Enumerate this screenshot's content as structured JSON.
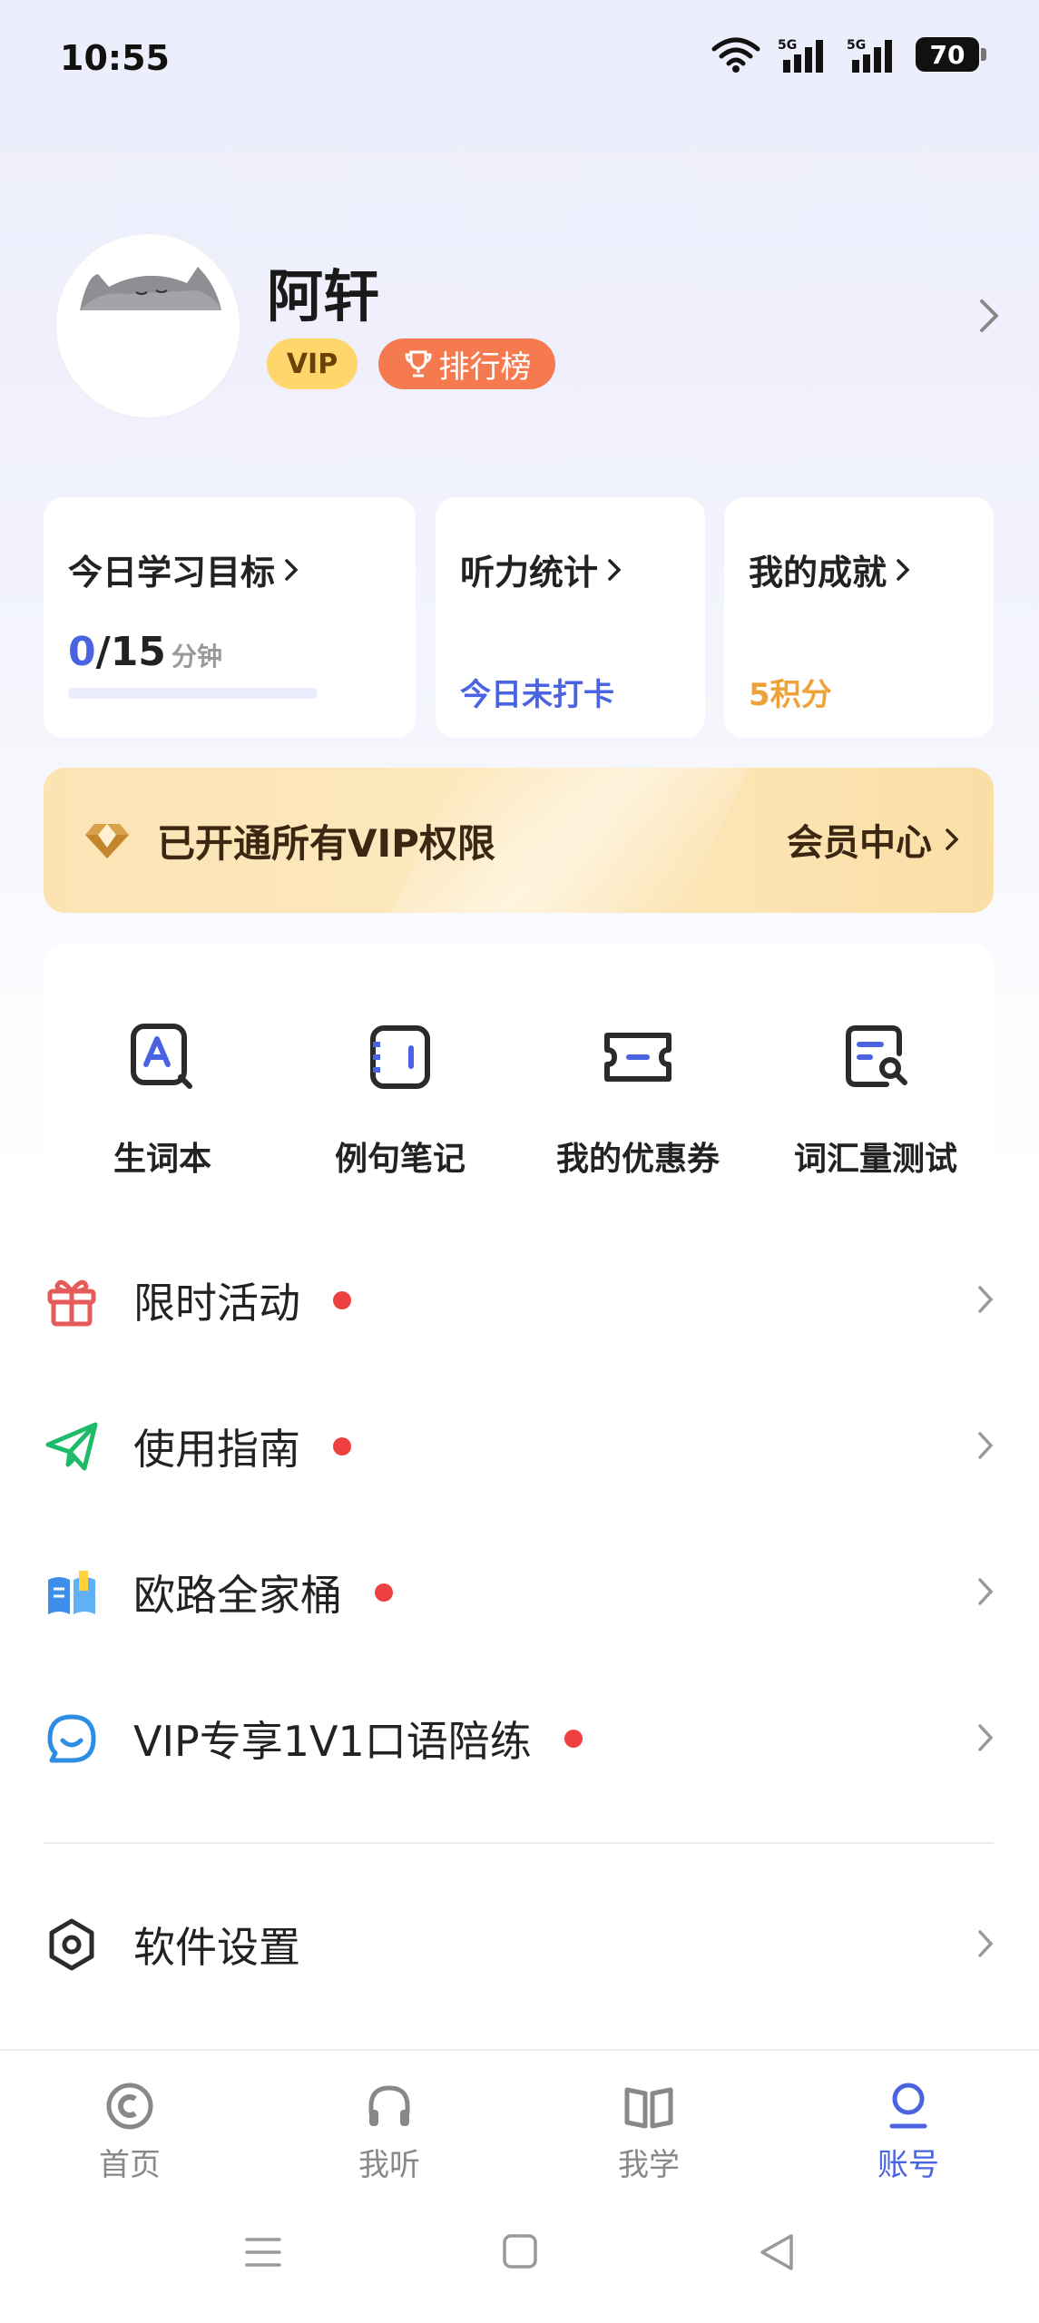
{
  "status_bar": {
    "time": "10:55",
    "battery": "70",
    "signal1": "5G",
    "signal2": "5G"
  },
  "profile": {
    "name": "阿轩",
    "vip_label": "VIP",
    "rank_label": "排行榜"
  },
  "cards": {
    "goal": {
      "title": "今日学习目标",
      "current": "0",
      "total": "/15",
      "unit": "分钟",
      "progress": 0
    },
    "listening": {
      "title": "听力统计",
      "status": "今日未打卡"
    },
    "achievement": {
      "title": "我的成就",
      "points": "5积分"
    }
  },
  "vip_banner": {
    "text": "已开通所有VIP权限",
    "center_label": "会员中心"
  },
  "tools": [
    {
      "label": "生词本",
      "icon": "vocabulary-book-icon"
    },
    {
      "label": "例句笔记",
      "icon": "sentence-notes-icon"
    },
    {
      "label": "我的优惠券",
      "icon": "coupon-icon"
    },
    {
      "label": "词汇量测试",
      "icon": "vocabulary-test-icon"
    }
  ],
  "menu": [
    {
      "label": "限时活动",
      "icon": "gift-icon",
      "has_dot": true
    },
    {
      "label": "使用指南",
      "icon": "paper-plane-icon",
      "has_dot": true
    },
    {
      "label": "欧路全家桶",
      "icon": "book-bundle-icon",
      "has_dot": true
    },
    {
      "label": "VIP专享1V1口语陪练",
      "icon": "chat-bubble-icon",
      "has_dot": true
    }
  ],
  "settings": {
    "label": "软件设置",
    "icon": "settings-icon"
  },
  "bottom_nav": [
    {
      "label": "首页",
      "icon": "home-icon",
      "active": false
    },
    {
      "label": "我听",
      "icon": "headphones-icon",
      "active": false
    },
    {
      "label": "我学",
      "icon": "open-book-icon",
      "active": false
    },
    {
      "label": "账号",
      "icon": "account-icon",
      "active": true
    }
  ],
  "colors": {
    "accent": "#4a63e0",
    "vip_gold": "#ffd66b",
    "rank_orange": "#f57a4f",
    "dot_red": "#ef4040",
    "points_orange": "#f0a23a"
  }
}
